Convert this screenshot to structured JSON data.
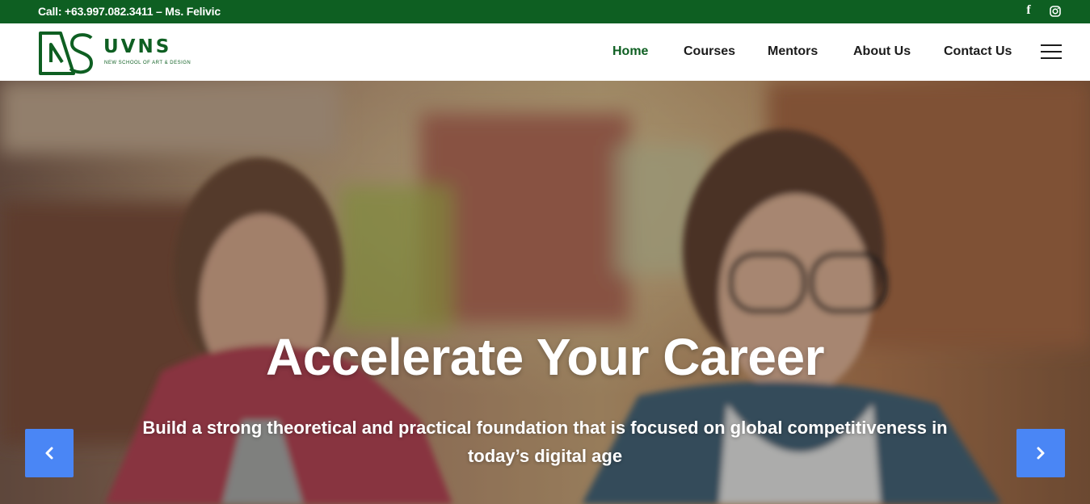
{
  "topbar": {
    "contact_text": "Call: +63.997.082.3411 – Ms. Felivic",
    "facebook_glyph": "f",
    "icons": [
      "facebook-icon",
      "instagram-icon"
    ]
  },
  "logo": {
    "brand": "UVNS",
    "tagline": "NEW SCHOOL OF ART & DESIGN"
  },
  "nav": {
    "items": [
      {
        "label": "Home",
        "active": true
      },
      {
        "label": "Courses",
        "active": false
      },
      {
        "label": "Mentors",
        "active": false
      },
      {
        "label": "About Us",
        "active": false
      },
      {
        "label": "Contact Us",
        "active": false
      }
    ],
    "menu_icon": "hamburger-menu-icon"
  },
  "hero": {
    "title": "Accelerate Your Career",
    "subtitle": "Build a strong theoretical and practical foundation that is focused on global competitiveness in today’s digital age",
    "prev_icon": "chevron-left-icon",
    "next_icon": "chevron-right-icon"
  },
  "colors": {
    "brand_green": "#0e5f22",
    "arrow_blue": "#4a86f5",
    "text_dark": "#1b1b1b"
  }
}
